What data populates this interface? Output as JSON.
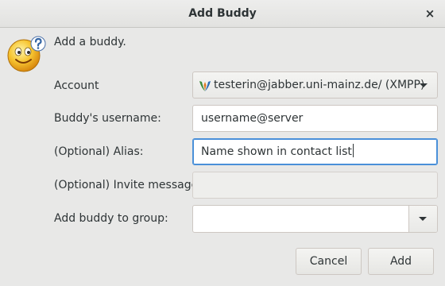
{
  "window": {
    "title": "Add Buddy",
    "close_symbol": "×"
  },
  "intro_text": "Add a buddy.",
  "icon": {
    "name": "buddy-question-smiley-icon"
  },
  "form": {
    "account": {
      "label": "Account",
      "value": "testerin@jabber.uni-mainz.de/ (XMPP)",
      "icon": "xmpp-protocol-icon"
    },
    "username": {
      "label": "Buddy's username:",
      "value": "username@server"
    },
    "alias": {
      "label": "(Optional) Alias:",
      "value": "Name shown in contact list"
    },
    "invite": {
      "label": "(Optional) Invite message:",
      "value": ""
    },
    "group": {
      "label": "Add buddy to group:",
      "value": ""
    }
  },
  "buttons": {
    "cancel": "Cancel",
    "add": "Add"
  },
  "colors": {
    "background": "#e8e8e7",
    "focus_border": "#4a90d9",
    "text": "#2e3436"
  }
}
